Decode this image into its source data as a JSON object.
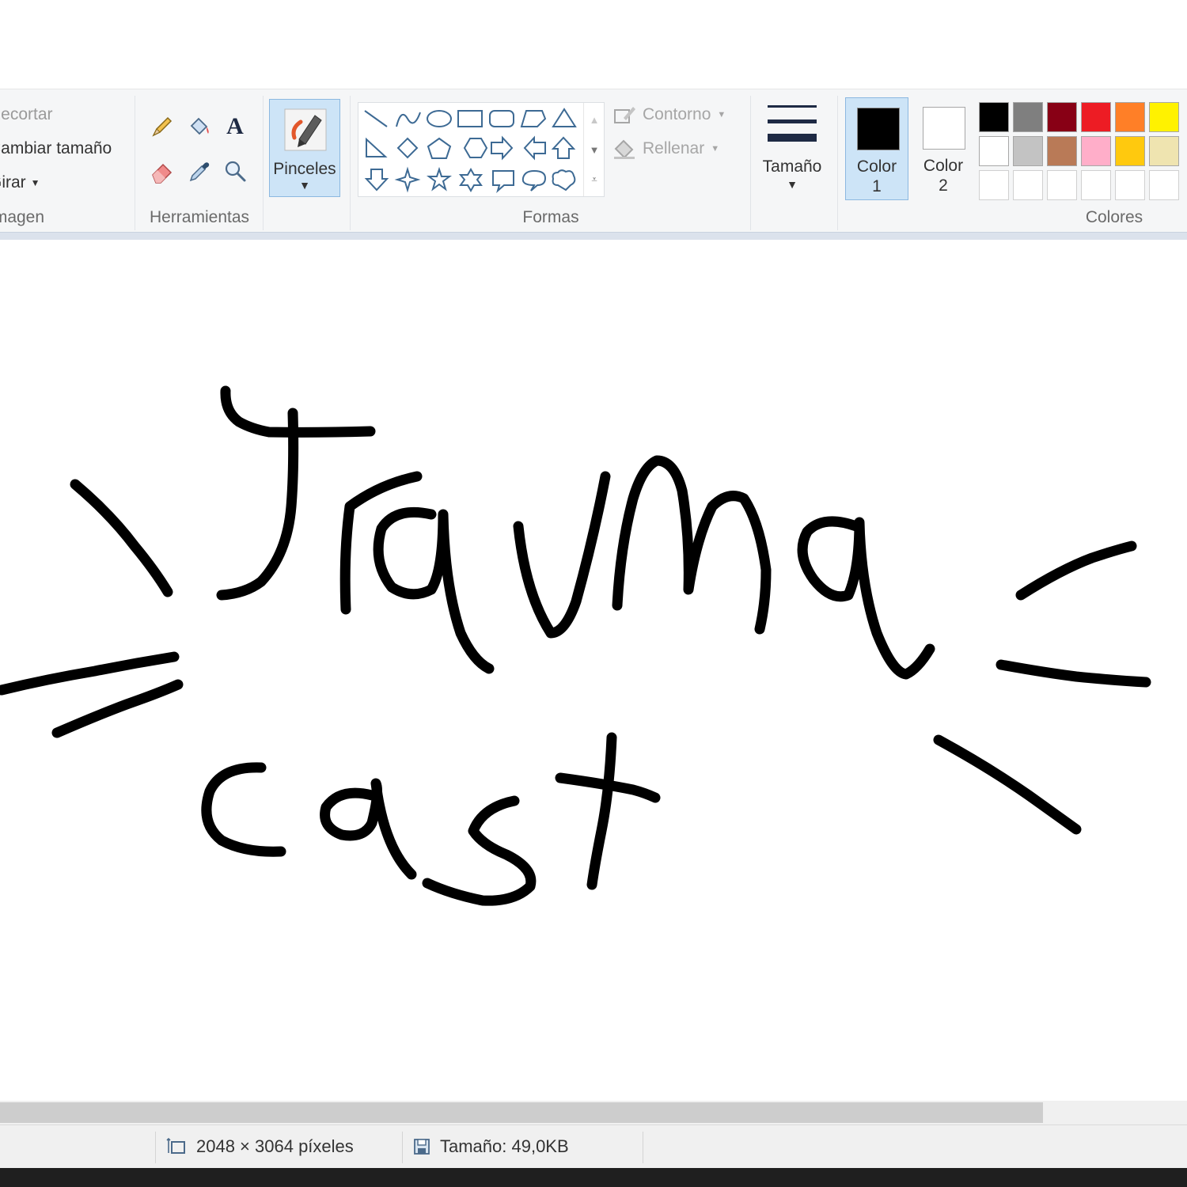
{
  "ribbon": {
    "image_group": {
      "crop_label": "Recortar",
      "resize_label": "Cambiar tamaño",
      "rotate_label": "Girar",
      "group_label": "Imagen"
    },
    "tools_group": {
      "group_label": "Herramientas",
      "text_tool_glyph": "A"
    },
    "brushes": {
      "label": "Pinceles"
    },
    "shapes_group": {
      "group_label": "Formas",
      "outline_label": "Contorno",
      "fill_label": "Rellenar"
    },
    "size": {
      "label": "Tamaño"
    },
    "color1": {
      "label_line1": "Color",
      "label_line2": "1",
      "value": "#000000"
    },
    "color2": {
      "label_line1": "Color",
      "label_line2": "2",
      "value": "#ffffff"
    },
    "colors_group": {
      "group_label": "Colores",
      "palette_row1": [
        "#000000",
        "#7f7f7f",
        "#880015",
        "#ed1c24",
        "#ff7f27",
        "#fff200"
      ],
      "palette_row2": [
        "#ffffff",
        "#c3c3c3",
        "#b97a57",
        "#ffaec9",
        "#ffc90e",
        "#efe4b0"
      ],
      "palette_row3": [
        "#ffffff",
        "#ffffff",
        "#ffffff",
        "#ffffff",
        "#ffffff",
        "#ffffff"
      ]
    }
  },
  "canvas": {
    "drawing_words": [
      "Trauma",
      "cast"
    ],
    "stroke_color": "#000000"
  },
  "statusbar": {
    "dimensions": "2048 × 3064 píxeles",
    "file_size": "Tamaño: 49,0KB"
  },
  "icons": {
    "select_size_icon": "canvas-size-icon",
    "save_icon": "disk-icon"
  }
}
